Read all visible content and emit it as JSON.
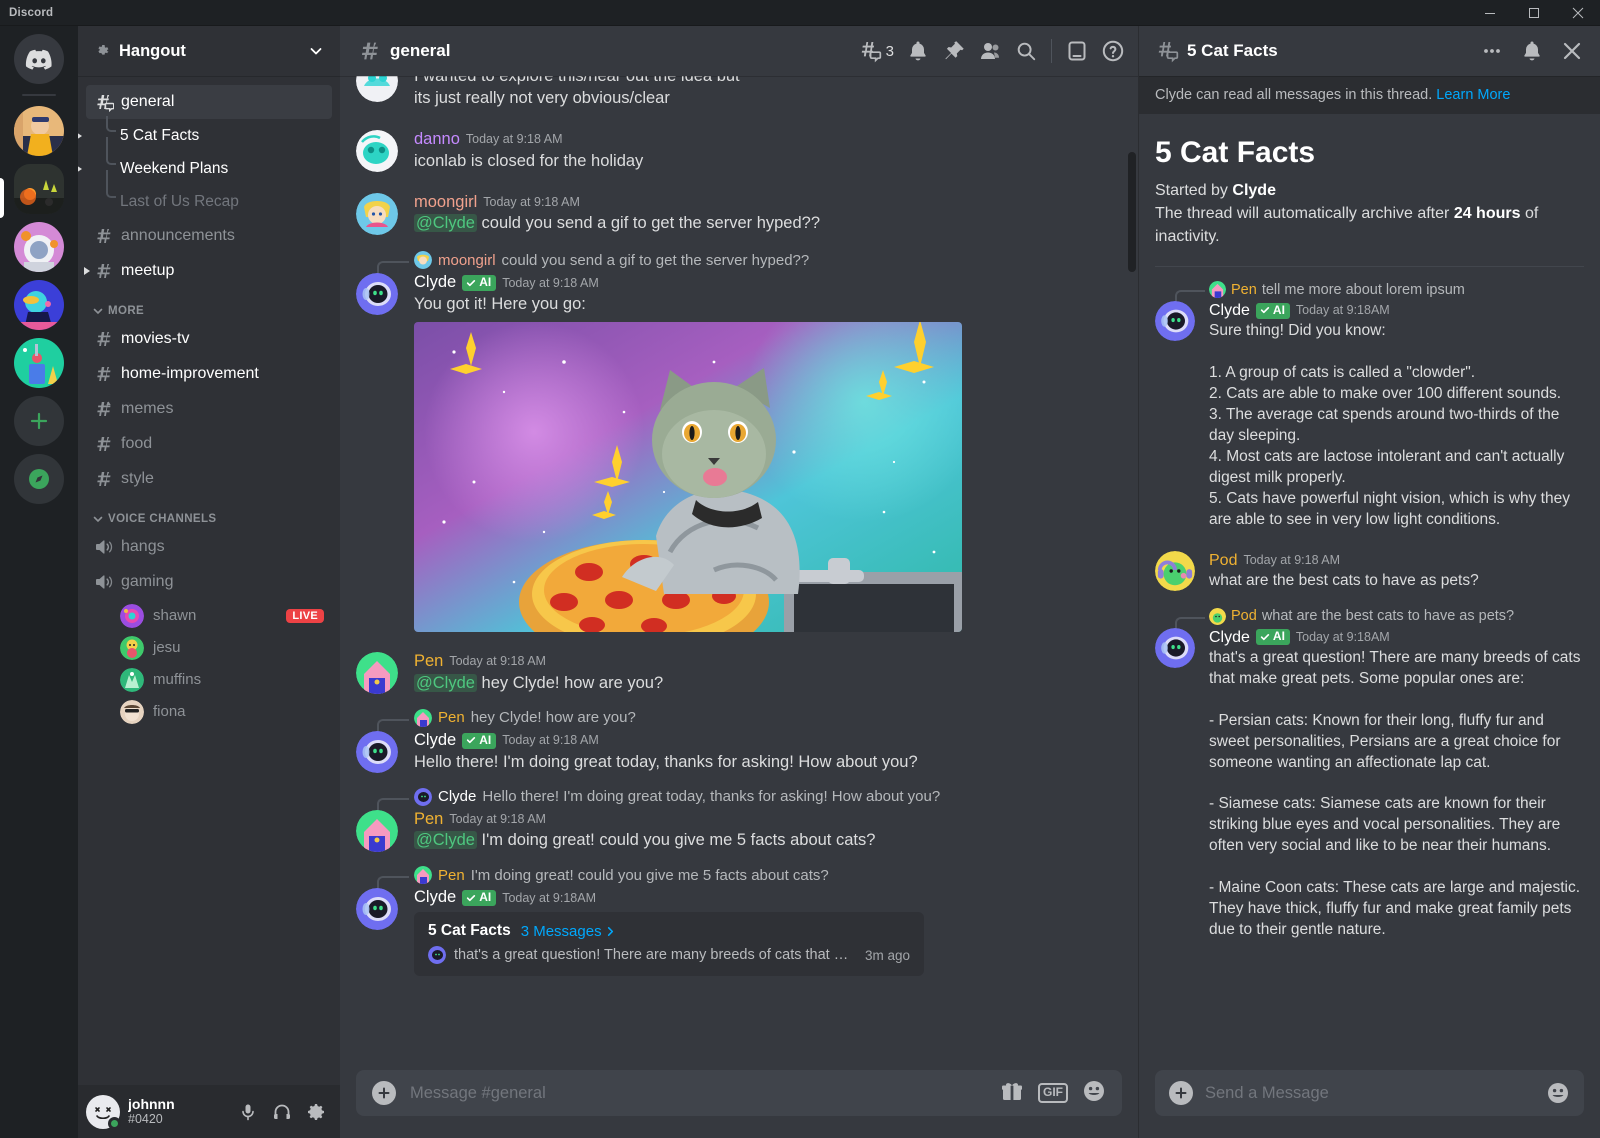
{
  "window": {
    "brand": "Discord",
    "minimize": "minimize",
    "maximize": "maximize",
    "close": "close"
  },
  "sidebar": {
    "guild_name": "Hangout",
    "channels": [
      {
        "name": "general",
        "icon": "hash-thread-icon",
        "state": "active"
      },
      {
        "name": "announcements",
        "icon": "hash-icon",
        "state": "muted"
      },
      {
        "name": "meetup",
        "icon": "hash-icon",
        "state": "unread"
      }
    ],
    "threads": [
      {
        "name": "5 Cat Facts",
        "state": "unread"
      },
      {
        "name": "Weekend Plans",
        "state": "unread"
      },
      {
        "name": "Last of Us Recap",
        "state": "muted"
      }
    ],
    "more_category": "MORE",
    "more_channels": [
      {
        "name": "movies-tv",
        "icon": "hash-icon",
        "state": "unread"
      },
      {
        "name": "home-improvement",
        "icon": "hash-icon",
        "state": "unread"
      },
      {
        "name": "memes",
        "icon": "hash-announce-icon",
        "state": "muted"
      },
      {
        "name": "food",
        "icon": "hash-icon",
        "state": "muted"
      },
      {
        "name": "style",
        "icon": "hash-icon",
        "state": "muted"
      }
    ],
    "voice_category": "VOICE CHANNELS",
    "voice_channels": [
      {
        "name": "hangs"
      },
      {
        "name": "gaming"
      }
    ],
    "voice_members": [
      {
        "name": "shawn",
        "badge": "LIVE"
      },
      {
        "name": "jesu",
        "badge": ""
      },
      {
        "name": "muffins",
        "badge": ""
      },
      {
        "name": "fiona",
        "badge": ""
      }
    ]
  },
  "user_panel": {
    "username": "johnnn",
    "tag": "#0420",
    "mic": "microphone-icon",
    "headset": "headset-icon",
    "settings": "gear-icon"
  },
  "chat_header": {
    "channel": "general",
    "threads_count": "3",
    "icons": [
      "threads-icon",
      "bell-icon",
      "pin-icon",
      "members-icon",
      "search-icon",
      "inbox-icon",
      "help-icon"
    ]
  },
  "messages": [
    {
      "type": "continuation",
      "lines": [
        "I wanted to explore this/hear out the idea but",
        "its just really not very obvious/clear"
      ]
    },
    {
      "type": "message",
      "author": "danno",
      "author_color": "#c58aff",
      "timestamp": "Today at 9:18 AM",
      "text": "iconlab is closed for the holiday"
    },
    {
      "type": "message",
      "author": "moongirl",
      "author_color": "#f0a18d",
      "timestamp": "Today at 9:18 AM",
      "mention": "@Clyde",
      "text": "could you send a gif to get the server hyped??"
    },
    {
      "type": "reply",
      "reply_author": "moongirl",
      "reply_author_color": "#f0a18d",
      "reply_text": "could you send a gif to get the server hyped??",
      "author": "Clyde",
      "author_color": "#ffffff",
      "badge": "AI",
      "timestamp": "Today at 9:18 AM",
      "text": "You got it! Here you go:",
      "attachment": "space-cat-pizza-gif"
    },
    {
      "type": "message",
      "author": "Pen",
      "author_color": "#f0b232",
      "timestamp": "Today at 9:18 AM",
      "mention": "@Clyde",
      "text": "hey Clyde! how are you?"
    },
    {
      "type": "reply",
      "reply_author": "Pen",
      "reply_author_color": "#f0b232",
      "reply_text": "hey Clyde! how are you?",
      "author": "Clyde",
      "author_color": "#ffffff",
      "badge": "AI",
      "timestamp": "Today at 9:18 AM",
      "text": "Hello there! I'm doing great today, thanks for asking! How about you?"
    },
    {
      "type": "reply",
      "reply_author": "Clyde",
      "reply_author_color": "#ffffff",
      "reply_text": "Hello there! I'm doing great today, thanks for asking! How about you?",
      "author": "Pen",
      "author_color": "#f0b232",
      "timestamp": "Today at 9:18 AM",
      "mention": "@Clyde",
      "text": "I'm doing great! could you give me 5 facts about cats?"
    },
    {
      "type": "reply_thread",
      "reply_author": "Pen",
      "reply_author_color": "#f0b232",
      "reply_text": "I'm doing great! could you give me 5 facts about cats?",
      "author": "Clyde",
      "author_color": "#ffffff",
      "badge": "AI",
      "timestamp": "Today at 9:18AM"
    }
  ],
  "thread_card": {
    "title": "5 Cat Facts",
    "messages_label": "3 Messages",
    "preview": "that's a great question! There are many breeds of cats that ma...",
    "ago": "3m ago"
  },
  "composer": {
    "placeholder": "Message #general",
    "plus": "plus-icon",
    "gift": "gift-icon",
    "gif": "GIF",
    "emoji": "emoji-icon"
  },
  "thread_panel": {
    "title": "5 Cat Facts",
    "more": "more-options-icon",
    "bell": "bell-icon",
    "close": "close-icon",
    "notice": "Clyde can read all messages in this thread.",
    "notice_link": "Learn More",
    "heading": "5 Cat Facts",
    "started_by_label": "Started by",
    "started_by": "Clyde",
    "archive_prefix": "The thread will automatically archive after",
    "archive_time": "24 hours",
    "archive_suffix": "of inactivity.",
    "messages": [
      {
        "type": "reply",
        "reply_author": "Pen",
        "reply_author_color": "#f0b232",
        "reply_text": "tell me more about lorem ipsum",
        "author": "Clyde",
        "author_color": "#ffffff",
        "badge": "AI",
        "timestamp": "Today at 9:18AM",
        "text": "Sure thing! Did you know:",
        "list": [
          "1. A group of cats is called a \"clowder\".",
          "2. Cats are able to make over 100 different sounds.",
          " 3. The average cat spends around two-thirds of the day sleeping.",
          "4. Most cats are lactose intolerant and can't actually digest milk properly.",
          "5. Cats have powerful night vision, which is why they are able to see in very low light conditions."
        ]
      },
      {
        "type": "message",
        "author": "Pod",
        "author_color": "#f0b232",
        "timestamp": "Today at 9:18 AM",
        "text": "what are the best cats to have as pets?"
      },
      {
        "type": "reply",
        "reply_author": "Pod",
        "reply_author_color": "#f0b232",
        "reply_text": "what are the best cats to have as pets?",
        "author": "Clyde",
        "author_color": "#ffffff",
        "badge": "AI",
        "timestamp": "Today at 9:18AM",
        "text": "that's a great question! There are many breeds of cats that make great pets. Some popular ones are:",
        "paragraphs": [
          "- Persian cats: Known for their long, fluffy fur and sweet personalities, Persians are a great choice for someone wanting an affectionate lap cat.",
          "- Siamese cats: Siamese cats are known for their striking blue eyes and vocal personalities. They are often very social and like to be near their humans.",
          "- Maine Coon cats: These cats are large and majestic. They have thick, fluffy fur and make great family pets due to their gentle nature."
        ]
      }
    ],
    "composer_placeholder": "Send a Message",
    "composer_plus": "plus-icon",
    "composer_emoji": "emoji-icon"
  },
  "colors": {
    "accent_blue": "#00a8fc",
    "ai_green": "#3ba55c",
    "live_red": "#ed4245",
    "bg_chat": "#36393f",
    "bg_sidebar": "#2f3136",
    "bg_rail": "#1e2124"
  }
}
